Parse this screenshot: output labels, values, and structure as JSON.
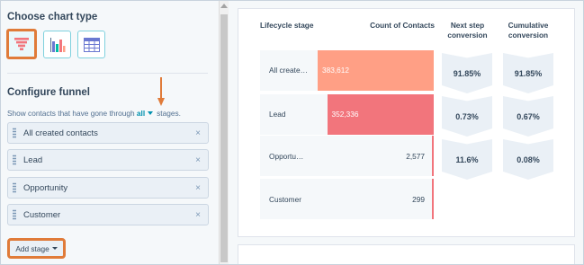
{
  "left_panel": {
    "chart_type_title": "Choose chart type",
    "chart_types": [
      {
        "icon": "funnel-chart-icon",
        "selected": true
      },
      {
        "icon": "bar-chart-icon",
        "selected": false
      },
      {
        "icon": "table-chart-icon",
        "selected": false
      }
    ],
    "configure_title": "Configure funnel",
    "description_prefix": "Show contacts that have gone through",
    "description_option": "all",
    "description_suffix": "stages.",
    "stages": [
      {
        "label": "All created contacts"
      },
      {
        "label": "Lead"
      },
      {
        "label": "Opportunity"
      },
      {
        "label": "Customer"
      }
    ],
    "remove_glyph": "×",
    "add_stage_label": "Add stage"
  },
  "table": {
    "headers": {
      "stage": "Lifecycle stage",
      "count": "Count of Contacts",
      "next_step": "Next step conversion",
      "cumulative": "Cumulative conversion"
    },
    "rows": [
      {
        "stage": "All create…",
        "count": "383,612",
        "next_step": "91.85%",
        "cumulative": "91.85%"
      },
      {
        "stage": "Lead",
        "count": "352,336",
        "next_step": "0.73%",
        "cumulative": "0.67%"
      },
      {
        "stage": "Opportu…",
        "count": "2,577",
        "next_step": "11.6%",
        "cumulative": "0.08%"
      },
      {
        "stage": "Customer",
        "count": "299",
        "next_step": "",
        "cumulative": ""
      }
    ]
  },
  "chart_data": {
    "type": "bar",
    "categories": [
      "All created contacts",
      "Lead",
      "Opportunity",
      "Customer"
    ],
    "values": [
      383612,
      352336,
      2577,
      299
    ],
    "colors": [
      "#ff9f85",
      "#f2757c",
      "#f2757c",
      "#f2757c"
    ]
  }
}
